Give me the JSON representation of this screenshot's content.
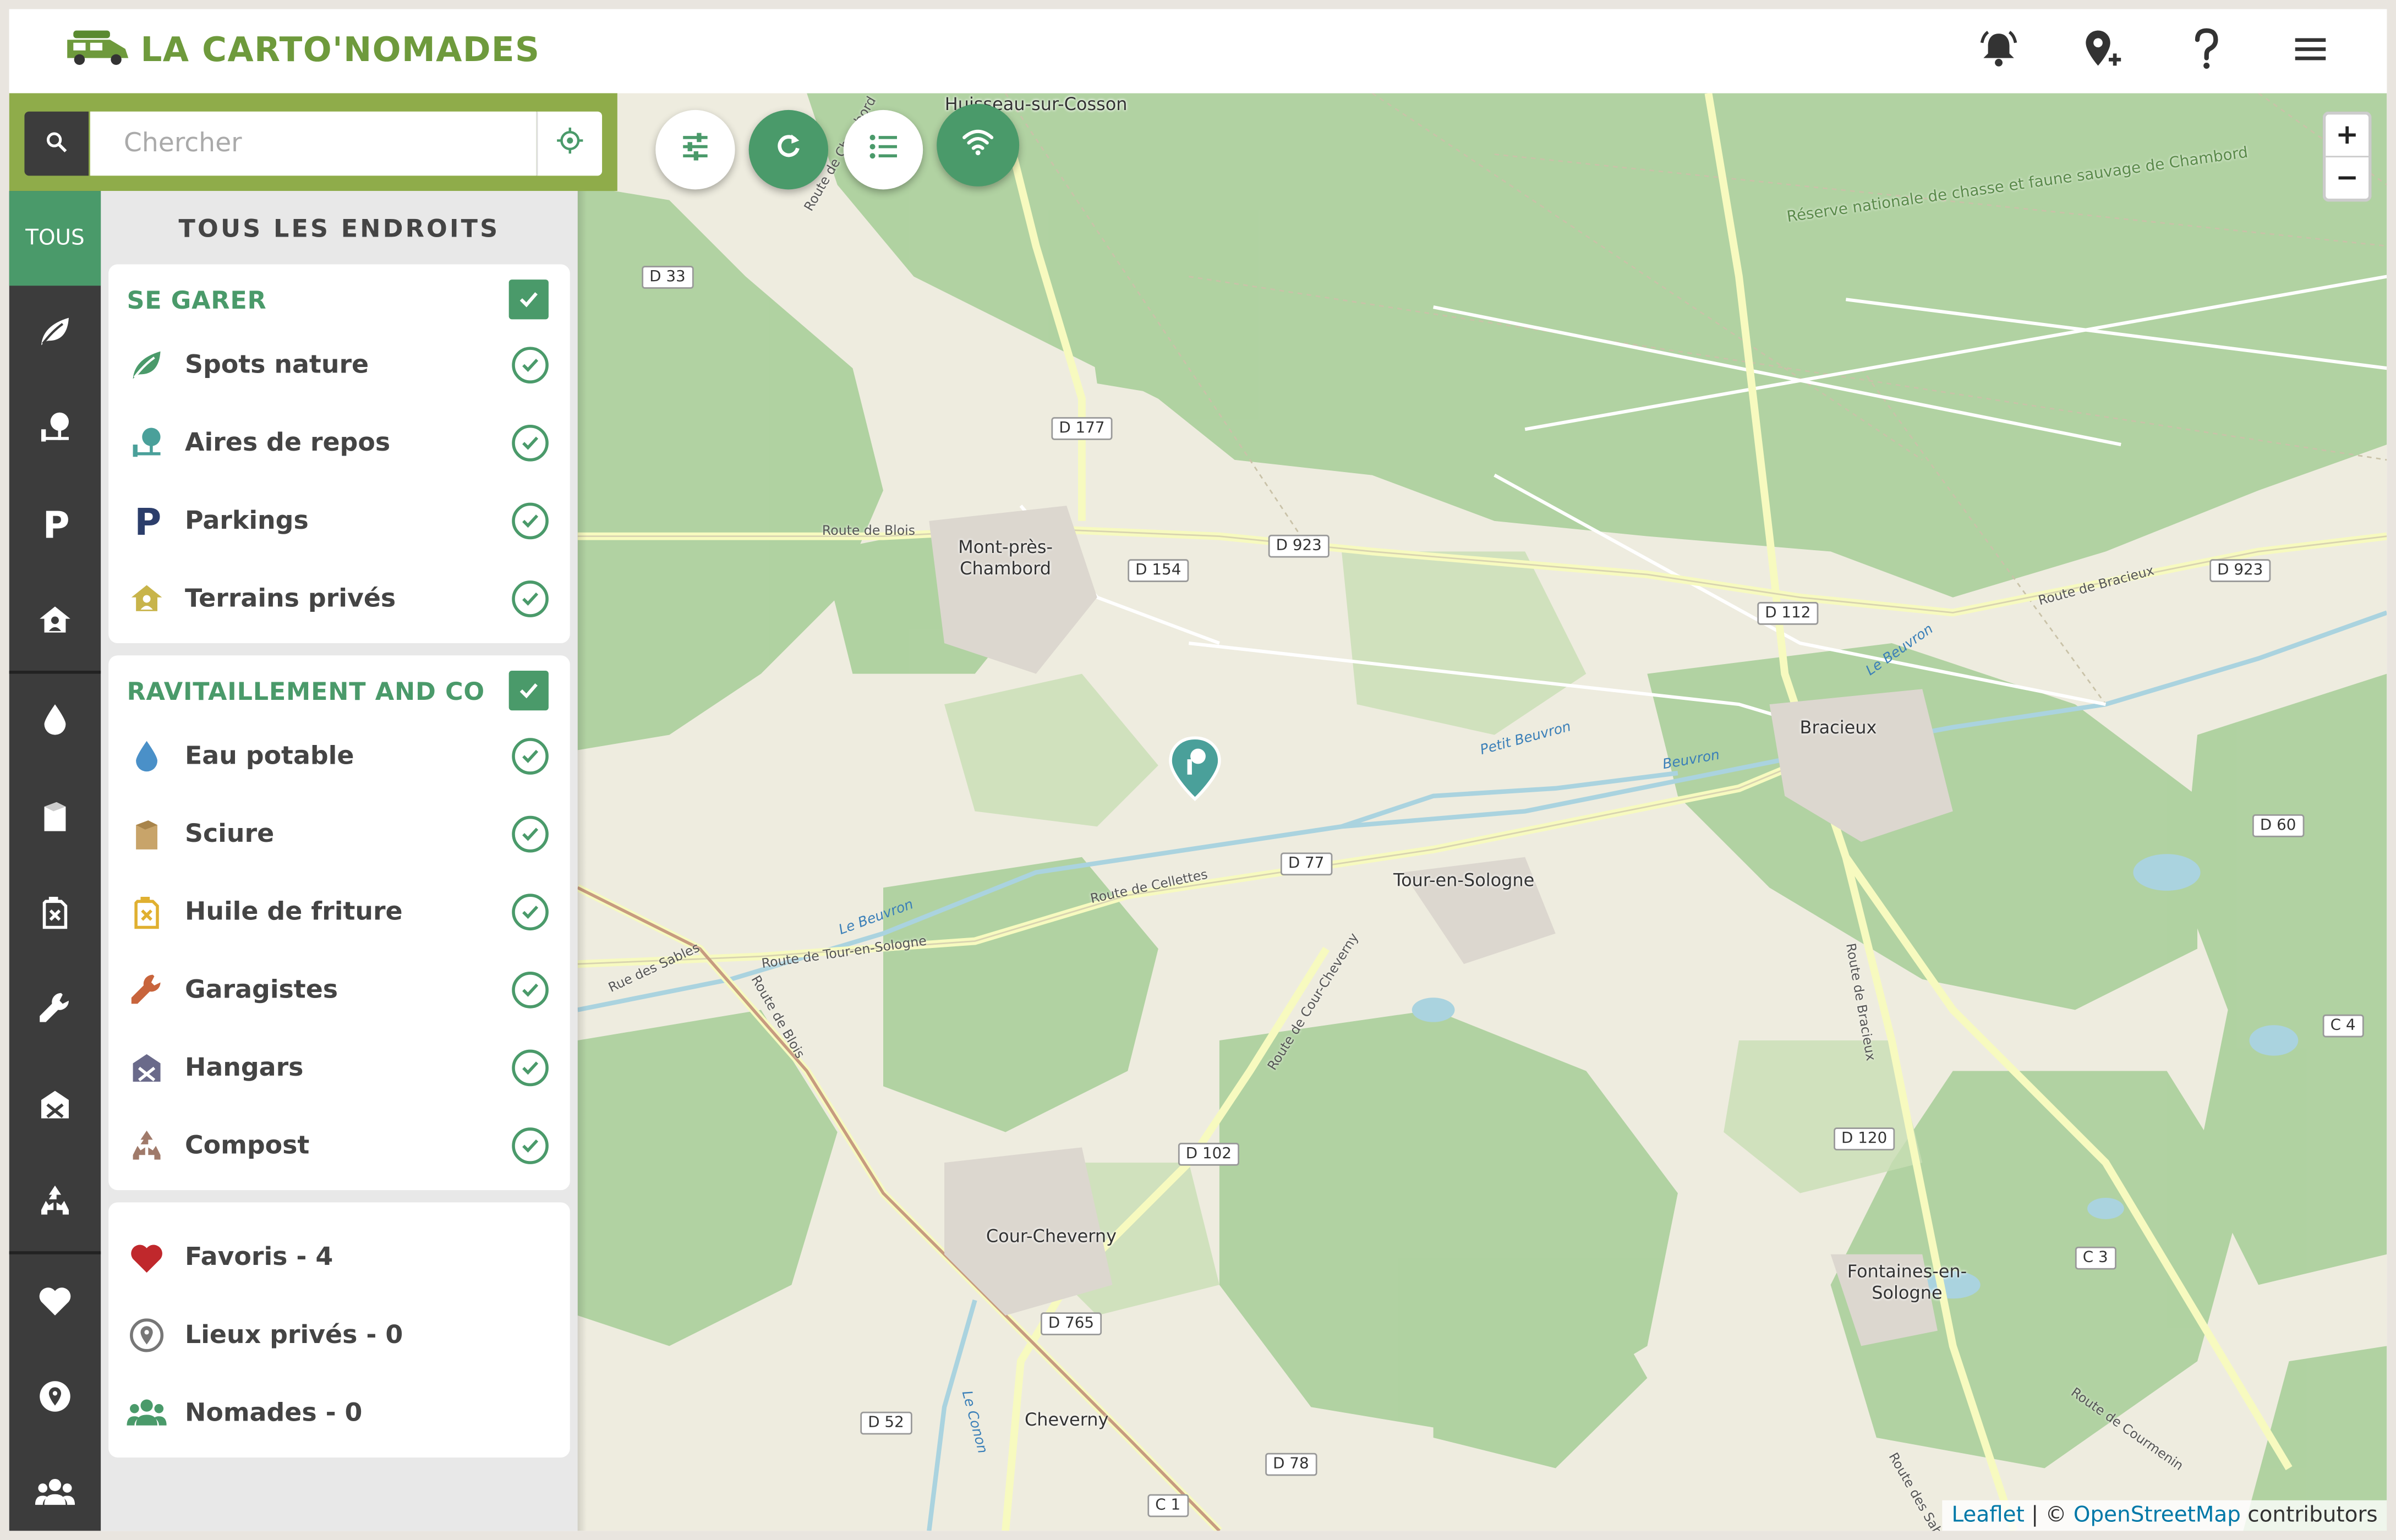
{
  "header": {
    "app_title": "LA CARTO'NOMADES",
    "icons": [
      "bell-icon",
      "add-location-icon",
      "help-icon",
      "menu-icon"
    ]
  },
  "search": {
    "placeholder": "Chercher",
    "value": ""
  },
  "toolbar": {
    "buttons": [
      "filters-icon",
      "refresh-icon",
      "list-icon",
      "wifi-icon"
    ]
  },
  "rail": {
    "tous_label": "TOUS",
    "items": [
      "leaf-icon",
      "rest-area-icon",
      "parking-icon",
      "private-land-icon",
      "water-drop-icon",
      "sawdust-icon",
      "frying-oil-icon",
      "wrench-icon",
      "hangar-icon",
      "compost-icon",
      "heart-icon",
      "location-icon",
      "users-icon"
    ]
  },
  "panel": {
    "title": "TOUS LES ENDROITS",
    "sections": [
      {
        "title": "SE GARER",
        "items": [
          {
            "label": "Spots nature",
            "icon": "leaf-icon",
            "color": "#4a9a6a"
          },
          {
            "label": "Aires de repos",
            "icon": "rest-area-icon",
            "color": "#4aa09a"
          },
          {
            "label": "Parkings",
            "icon": "parking-icon",
            "color": "#2c3e6b"
          },
          {
            "label": "Terrains privés",
            "icon": "private-land-icon",
            "color": "#c8b44a"
          }
        ]
      },
      {
        "title": "RAVITAILLEMENT AND CO",
        "items": [
          {
            "label": "Eau potable",
            "icon": "water-drop-icon",
            "color": "#4a90c8"
          },
          {
            "label": "Sciure",
            "icon": "sawdust-icon",
            "color": "#c8a46a"
          },
          {
            "label": "Huile de friture",
            "icon": "frying-oil-icon",
            "color": "#e0b030"
          },
          {
            "label": "Garagistes",
            "icon": "wrench-icon",
            "color": "#c8643c"
          },
          {
            "label": "Hangars",
            "icon": "hangar-icon",
            "color": "#6a6a8a"
          },
          {
            "label": "Compost",
            "icon": "compost-icon",
            "color": "#a07a6a"
          }
        ]
      }
    ],
    "personal": [
      {
        "label": "Favoris - 4",
        "icon": "heart-icon",
        "color": "#c0282c"
      },
      {
        "label": "Lieux privés - 0",
        "icon": "location-icon",
        "color": "#777777"
      },
      {
        "label": "Nomades - 0",
        "icon": "users-icon",
        "color": "#4a9a6a"
      }
    ]
  },
  "map": {
    "zoom_in": "+",
    "zoom_out": "−",
    "attribution": {
      "leaflet": "Leaflet",
      "sep": " | © ",
      "osm": "OpenStreetMap",
      "suffix": " contributors"
    },
    "places": [
      "Huisseau-sur-Cosson",
      "Mont-près-Chambord",
      "Bracieux",
      "Tour-en-Sologne",
      "Cour-Cheverny",
      "Cheverny",
      "Fontaines-en-Sologne"
    ],
    "roads": [
      "D 33",
      "D 177",
      "D 154",
      "D 923",
      "D 923",
      "D 112",
      "D 77",
      "D 60",
      "D 102",
      "D 120",
      "D 765",
      "D 52",
      "D 78",
      "C 1",
      "C 3",
      "C 4"
    ],
    "road_names": [
      "Route de Blois",
      "Route de Chambord",
      "Route de Bracieux",
      "Route de Cellettes",
      "Route de Tour-en-Sologne",
      "Rue des Sables",
      "Route de Blois",
      "Route de Cour-Cheverny",
      "Route de Bracieux",
      "Route de Courmenin",
      "Route des Sablons"
    ],
    "rivers": [
      "Le Beuvron",
      "Petit Beuvron",
      "Beuvron",
      "Le Beuvron",
      "Le Conon"
    ],
    "reserve": "Réserve nationale de chasse et faune sauvage de Chambord"
  },
  "colors": {
    "accent": "#4a9a6a",
    "logo": "#6e9a3c",
    "searchbar": "#8fac4a",
    "rail": "#3c3c3c"
  }
}
